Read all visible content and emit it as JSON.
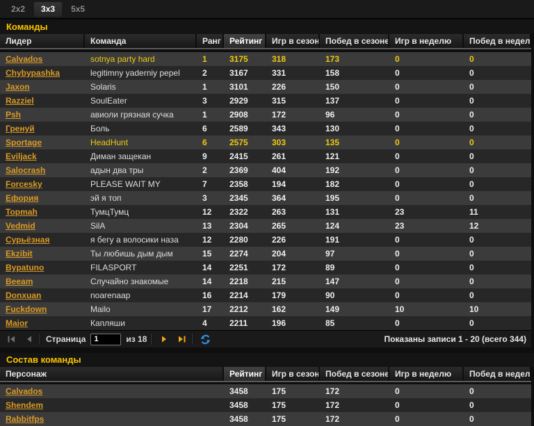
{
  "tabs": [
    {
      "label": "2x2",
      "selected": false
    },
    {
      "label": "3x3",
      "selected": true
    },
    {
      "label": "5x5",
      "selected": false
    }
  ],
  "icons": {
    "sort_desc": "▼"
  },
  "colors": {
    "accent_gold": "#fcc500",
    "link_orange": "#d99a26",
    "highlight_yellow": "#edc90f",
    "pager_arrow_orange": "#f0a713",
    "refresh_blue": "#2f8fe0"
  },
  "teams": {
    "title": "Команды",
    "columns": [
      "Лидер",
      "Команда",
      "Ранг",
      "Рейтинг",
      "Игр в сезоне",
      "Побед в сезоне",
      "Игр в неделю",
      "Побед в неделю"
    ],
    "sorted_column": "Рейтинг",
    "sort_direction": "desc",
    "rows": [
      {
        "leader": "Calvados",
        "team": "sotnya party hard",
        "rank": "1",
        "rating": "3175",
        "games_season": "318",
        "wins_season": "173",
        "games_week": "0",
        "wins_week": "0",
        "highlighted": true
      },
      {
        "leader": "Chybypashka",
        "team": "legitimny yaderniy pepel",
        "rank": "2",
        "rating": "3167",
        "games_season": "331",
        "wins_season": "158",
        "games_week": "0",
        "wins_week": "0",
        "highlighted": false
      },
      {
        "leader": "Jaxon",
        "team": "Solaris",
        "rank": "1",
        "rating": "3101",
        "games_season": "226",
        "wins_season": "150",
        "games_week": "0",
        "wins_week": "0",
        "highlighted": false
      },
      {
        "leader": "Razziel",
        "team": "SoulEater",
        "rank": "3",
        "rating": "2929",
        "games_season": "315",
        "wins_season": "137",
        "games_week": "0",
        "wins_week": "0",
        "highlighted": false
      },
      {
        "leader": "Psh",
        "team": "авиоли грязная сучка",
        "rank": "1",
        "rating": "2908",
        "games_season": "172",
        "wins_season": "96",
        "games_week": "0",
        "wins_week": "0",
        "highlighted": false
      },
      {
        "leader": "Гренуй",
        "team": "Боль",
        "rank": "6",
        "rating": "2589",
        "games_season": "343",
        "wins_season": "130",
        "games_week": "0",
        "wins_week": "0",
        "highlighted": false
      },
      {
        "leader": "Sportage",
        "team": "HeadHunt",
        "rank": "6",
        "rating": "2575",
        "games_season": "303",
        "wins_season": "135",
        "games_week": "0",
        "wins_week": "0",
        "highlighted": true
      },
      {
        "leader": "Eviljack",
        "team": "Диман защекан",
        "rank": "9",
        "rating": "2415",
        "games_season": "261",
        "wins_season": "121",
        "games_week": "0",
        "wins_week": "0",
        "highlighted": false
      },
      {
        "leader": "Salocrash",
        "team": "адын два тры",
        "rank": "2",
        "rating": "2369",
        "games_season": "404",
        "wins_season": "192",
        "games_week": "0",
        "wins_week": "0",
        "highlighted": false
      },
      {
        "leader": "Forcesky",
        "team": "PLEASE WAIT MY",
        "rank": "7",
        "rating": "2358",
        "games_season": "194",
        "wins_season": "182",
        "games_week": "0",
        "wins_week": "0",
        "highlighted": false
      },
      {
        "leader": "Ефория",
        "team": "эй я топ",
        "rank": "3",
        "rating": "2345",
        "games_season": "364",
        "wins_season": "195",
        "games_week": "0",
        "wins_week": "0",
        "highlighted": false
      },
      {
        "leader": "Topmah",
        "team": "ТумцТумц",
        "rank": "12",
        "rating": "2322",
        "games_season": "263",
        "wins_season": "131",
        "games_week": "23",
        "wins_week": "11",
        "highlighted": false
      },
      {
        "leader": "Vedmid",
        "team": "SilA",
        "rank": "13",
        "rating": "2304",
        "games_season": "265",
        "wins_season": "124",
        "games_week": "23",
        "wins_week": "12",
        "highlighted": false
      },
      {
        "leader": "Сурьёзная",
        "team": "я бегу а волосики наза",
        "rank": "12",
        "rating": "2280",
        "games_season": "226",
        "wins_season": "191",
        "games_week": "0",
        "wins_week": "0",
        "highlighted": false
      },
      {
        "leader": "Ekzibit",
        "team": "Ты любишь дым дым",
        "rank": "15",
        "rating": "2274",
        "games_season": "204",
        "wins_season": "97",
        "games_week": "0",
        "wins_week": "0",
        "highlighted": false
      },
      {
        "leader": "Bypatuno",
        "team": "FILASPORT",
        "rank": "14",
        "rating": "2251",
        "games_season": "172",
        "wins_season": "89",
        "games_week": "0",
        "wins_week": "0",
        "highlighted": false
      },
      {
        "leader": "Beeam",
        "team": "Случайно знакомые",
        "rank": "14",
        "rating": "2218",
        "games_season": "215",
        "wins_season": "147",
        "games_week": "0",
        "wins_week": "0",
        "highlighted": false
      },
      {
        "leader": "Donxuan",
        "team": "noarenaap",
        "rank": "16",
        "rating": "2214",
        "games_season": "179",
        "wins_season": "90",
        "games_week": "0",
        "wins_week": "0",
        "highlighted": false
      },
      {
        "leader": "Fuckdown",
        "team": "Mailo",
        "rank": "17",
        "rating": "2212",
        "games_season": "162",
        "wins_season": "149",
        "games_week": "10",
        "wins_week": "10",
        "highlighted": false
      },
      {
        "leader": "Maior",
        "team": "Капляши",
        "rank": "4",
        "rating": "2211",
        "games_season": "196",
        "wins_season": "85",
        "games_week": "0",
        "wins_week": "0",
        "highlighted": false
      }
    ]
  },
  "pagination": {
    "page_label": "Страница",
    "page_value": "1",
    "of_label": "из 18",
    "summary": "Показаны записи 1 - 20 (всего 344)"
  },
  "roster": {
    "title": "Состав команды",
    "columns": [
      "Персонаж",
      "Рейтинг",
      "Игр в сезоне",
      "Побед в сезоне",
      "Игр в неделю",
      "Побед в неделю"
    ],
    "sorted_column": "Рейтинг",
    "sort_direction": "desc",
    "rows": [
      {
        "character": "Calvados",
        "rating": "3458",
        "games_season": "175",
        "wins_season": "172",
        "games_week": "0",
        "wins_week": "0"
      },
      {
        "character": "Shendem",
        "rating": "3458",
        "games_season": "175",
        "wins_season": "172",
        "games_week": "0",
        "wins_week": "0"
      },
      {
        "character": "Rabbitfps",
        "rating": "3458",
        "games_season": "175",
        "wins_season": "172",
        "games_week": "0",
        "wins_week": "0"
      }
    ]
  }
}
